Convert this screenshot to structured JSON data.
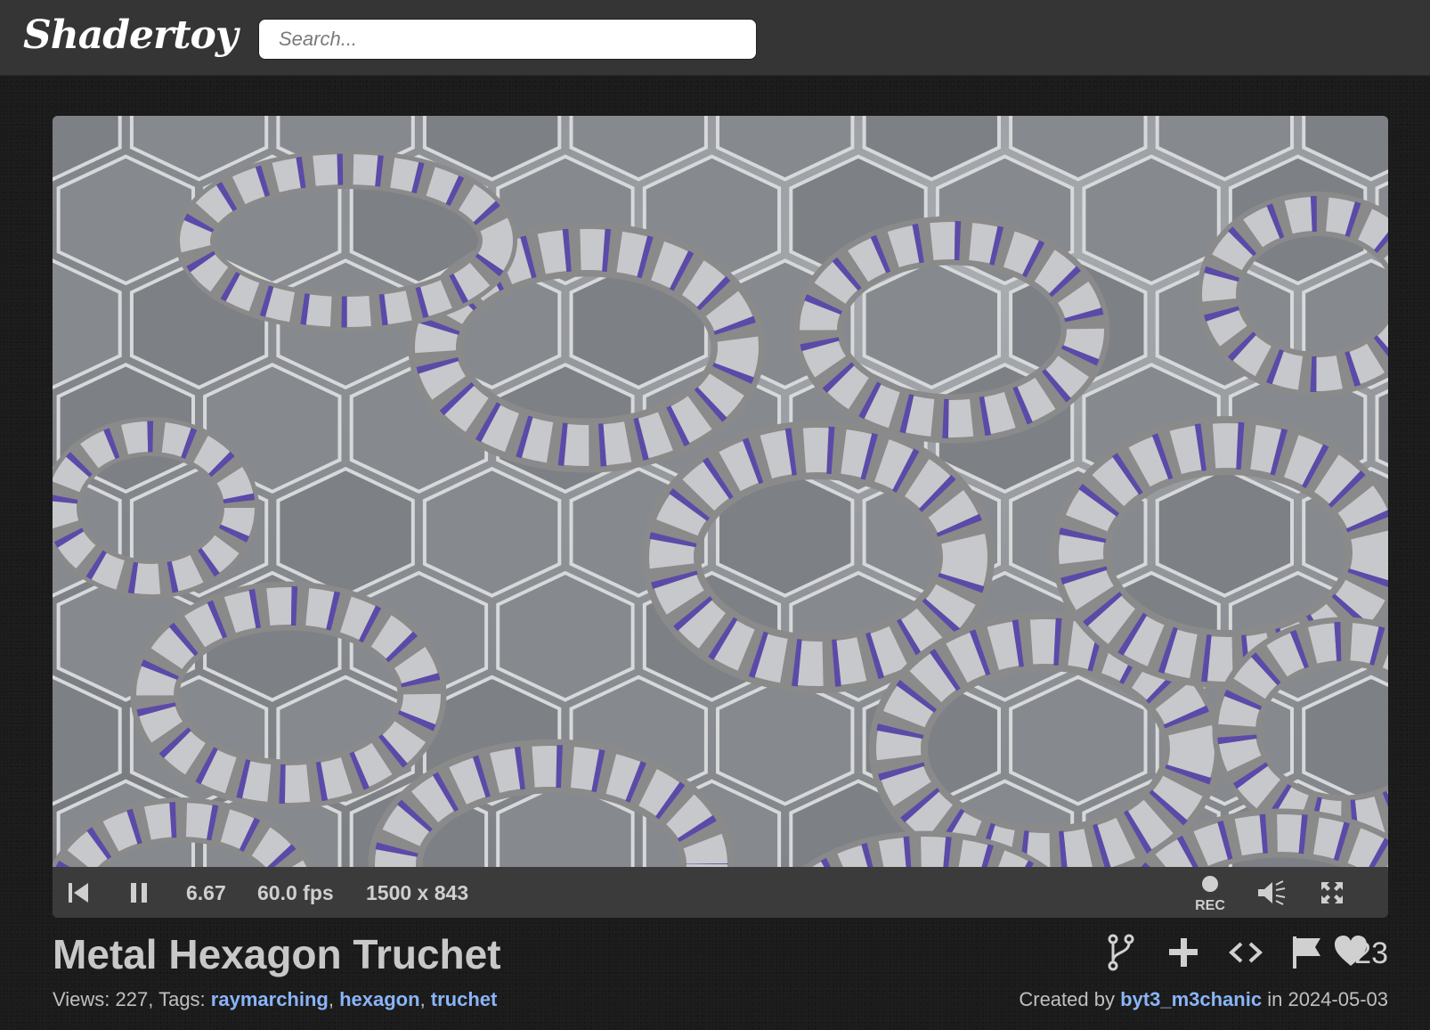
{
  "header": {
    "logo": "Shadertoy",
    "search_placeholder": "Search..."
  },
  "player": {
    "time": "6.67",
    "fps": "60.0 fps",
    "resolution": "1500 x 843",
    "rec_label": "REC",
    "icons": {
      "rewind": "skip-back-icon",
      "pause": "pause-icon",
      "record": "record-icon",
      "volume": "volume-icon",
      "fullscreen": "fullscreen-icon"
    },
    "colors": {
      "stripe": "#5b4aa8",
      "torus_light": "#c6c8cc",
      "torus_dark": "#8a8a8a",
      "floor": "#8e9196"
    }
  },
  "shader": {
    "title": "Metal Hexagon Truchet",
    "views_label": "Views:",
    "views_count": "227",
    "tags_label": "Tags:",
    "tags": [
      "raymarching",
      "hexagon",
      "truchet"
    ],
    "created_by_label": "Created by",
    "author": "byt3_m3chanic",
    "date_prefix": "in",
    "date": "2024-05-03",
    "likes": "23"
  },
  "actions": {
    "icons": [
      "fork-icon",
      "add-icon",
      "code-icon",
      "flag-icon",
      "heart-icon"
    ]
  },
  "theme": {
    "link_color": "#8ab4f8",
    "header_bg": "#353535",
    "page_bg": "#1b1b1b"
  }
}
